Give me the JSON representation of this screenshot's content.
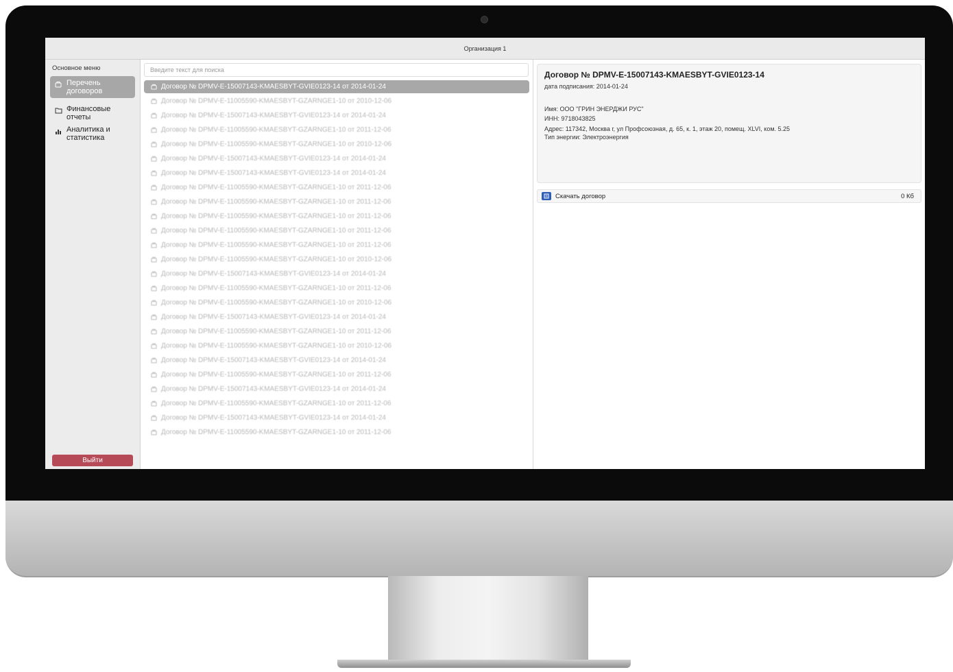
{
  "window": {
    "title": "Организация 1"
  },
  "sidebar": {
    "heading": "Основное меню",
    "items": [
      {
        "line1": "Перечень",
        "line2": "договоров",
        "icon": "contract-icon",
        "active": true
      },
      {
        "line1": "Финансовые",
        "line2": "отчеты",
        "icon": "folder-icon",
        "active": false
      },
      {
        "line1": "Аналитика и",
        "line2": "статистика",
        "icon": "bar-chart-icon",
        "active": false
      }
    ],
    "logout_label": "Выйти"
  },
  "search": {
    "placeholder": "Введите текст для поиска"
  },
  "contracts": [
    "Договор № DPMV-E-15007143-KMAESBYT-GVIE0123-14 от 2014-01-24",
    "Договор № DPMV-E-11005590-KMAESBYT-GZARNGE1-10 от 2010-12-06",
    "Договор № DPMV-E-15007143-KMAESBYT-GVIE0123-14 от 2014-01-24",
    "Договор № DPMV-E-11005590-KMAESBYT-GZARNGE1-10 от 2011-12-06",
    "Договор № DPMV-E-11005590-KMAESBYT-GZARNGE1-10 от 2010-12-06",
    "Договор № DPMV-E-15007143-KMAESBYT-GVIE0123-14 от 2014-01-24",
    "Договор № DPMV-E-15007143-KMAESBYT-GVIE0123-14 от 2014-01-24",
    "Договор № DPMV-E-11005590-KMAESBYT-GZARNGE1-10 от 2011-12-06",
    "Договор № DPMV-E-11005590-KMAESBYT-GZARNGE1-10 от 2011-12-06",
    "Договор № DPMV-E-11005590-KMAESBYT-GZARNGE1-10 от 2011-12-06",
    "Договор № DPMV-E-11005590-KMAESBYT-GZARNGE1-10 от 2011-12-06",
    "Договор № DPMV-E-11005590-KMAESBYT-GZARNGE1-10 от 2011-12-06",
    "Договор № DPMV-E-11005590-KMAESBYT-GZARNGE1-10 от 2010-12-06",
    "Договор № DPMV-E-15007143-KMAESBYT-GVIE0123-14 от 2014-01-24",
    "Договор № DPMV-E-11005590-KMAESBYT-GZARNGE1-10 от 2011-12-06",
    "Договор № DPMV-E-11005590-KMAESBYT-GZARNGE1-10 от 2010-12-06",
    "Договор № DPMV-E-15007143-KMAESBYT-GVIE0123-14 от 2014-01-24",
    "Договор № DPMV-E-11005590-KMAESBYT-GZARNGE1-10 от 2011-12-06",
    "Договор № DPMV-E-11005590-KMAESBYT-GZARNGE1-10 от 2010-12-06",
    "Договор № DPMV-E-15007143-KMAESBYT-GVIE0123-14 от 2014-01-24",
    "Договор № DPMV-E-11005590-KMAESBYT-GZARNGE1-10 от 2011-12-06",
    "Договор № DPMV-E-15007143-KMAESBYT-GVIE0123-14 от 2014-01-24",
    "Договор № DPMV-E-11005590-KMAESBYT-GZARNGE1-10 от 2011-12-06",
    "Договор № DPMV-E-15007143-KMAESBYT-GVIE0123-14 от 2014-01-24",
    "Договор № DPMV-E-11005590-KMAESBYT-GZARNGE1-10 от 2011-12-06"
  ],
  "detail": {
    "title": "Договор № DPMV-E-15007143-KMAESBYT-GVIE0123-14",
    "signed": "дата подписания: 2014-01-24",
    "name": "Имя: ООО \"ГРИН ЭНЕРДЖИ РУС\"",
    "inn": "ИНН: 9718043825",
    "address": "Адрес: 117342, Москва г, ул Профсоюзная, д. 65, к. 1, этаж 20, помещ. XLVI, ком. 5.25",
    "energy": "Тип энергии: Электроэнергия",
    "download_label": "Скачать договор",
    "file_size": "0 Кб"
  }
}
